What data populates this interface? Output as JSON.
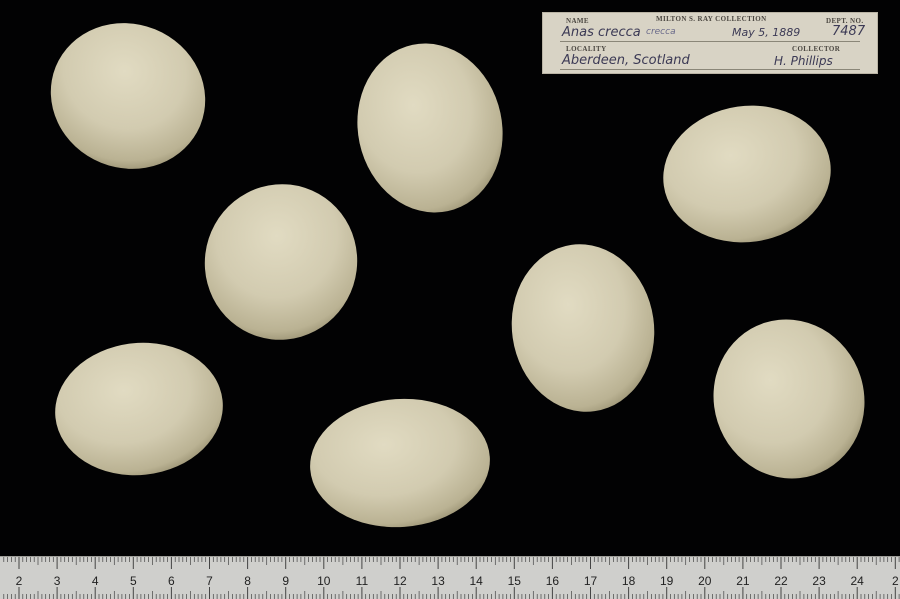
{
  "label": {
    "headings": {
      "name": "NAME",
      "collection": "MILTON S. RAY COLLECTION",
      "dept": "DEPT. NO.",
      "locality": "LOCALITY",
      "collector": "COLLECTOR"
    },
    "species": "Anas crecca",
    "subspecies": "crecca",
    "date": "May 5, 1889",
    "dept_no": "7487",
    "locality": "Aberdeen, Scotland",
    "collector": "H. Phillips"
  },
  "ruler": {
    "numbers": [
      "2",
      "3",
      "4",
      "5",
      "6",
      "7",
      "8",
      "9",
      "10",
      "11",
      "12",
      "13",
      "14",
      "15",
      "16",
      "17",
      "18",
      "19",
      "20",
      "21",
      "22",
      "23",
      "24",
      "2"
    ]
  },
  "colors": {
    "background": "#020203",
    "egg_shell": "#d4cdb1",
    "label_card": "#d8d3c5",
    "ruler": "#cfcfcc"
  }
}
